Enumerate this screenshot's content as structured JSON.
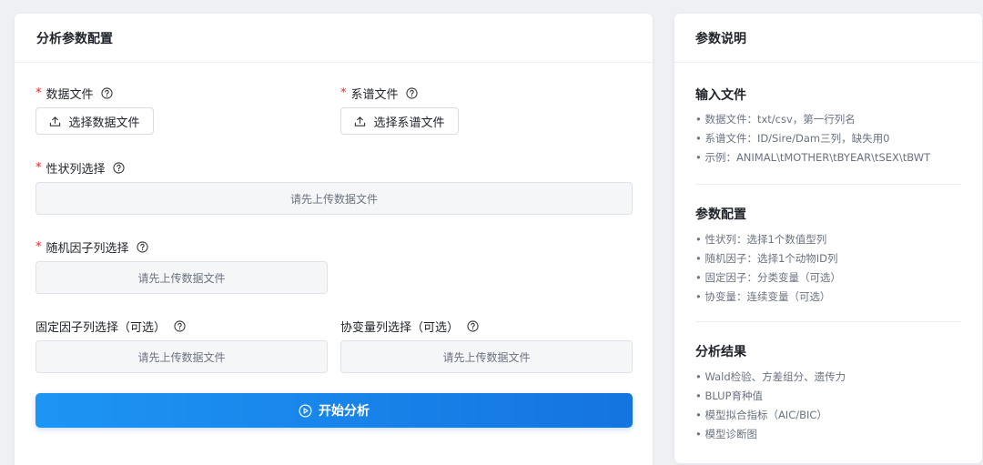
{
  "config_panel": {
    "title": "分析参数配置",
    "data_file": {
      "label": "数据文件",
      "button": "选择数据文件"
    },
    "pedigree_file": {
      "label": "系谱文件",
      "button": "选择系谱文件"
    },
    "trait_column": {
      "label": "性状列选择",
      "placeholder": "请先上传数据文件"
    },
    "random_factor": {
      "label": "随机因子列选择",
      "placeholder": "请先上传数据文件"
    },
    "fixed_factor": {
      "label": "固定因子列选择（可选）",
      "placeholder": "请先上传数据文件"
    },
    "covariate": {
      "label": "协变量列选择（可选）",
      "placeholder": "请先上传数据文件"
    },
    "start_button": "开始分析"
  },
  "help_panel": {
    "title": "参数说明",
    "sections": [
      {
        "title": "输入文件",
        "items": [
          "• 数据文件：txt/csv，第一行列名",
          "• 系谱文件：ID/Sire/Dam三列，缺失用0",
          "• 示例：ANIMAL\\tMOTHER\\tBYEAR\\tSEX\\tBWT"
        ]
      },
      {
        "title": "参数配置",
        "items": [
          "• 性状列：选择1个数值型列",
          "• 随机因子：选择1个动物ID列",
          "• 固定因子：分类变量（可选）",
          "• 协变量：连续变量（可选）"
        ]
      },
      {
        "title": "分析结果",
        "items": [
          "• Wald检验、方差组分、遗传力",
          "• BLUP育种值",
          "• 模型拟合指标（AIC/BIC）",
          "• 模型诊断图"
        ]
      }
    ]
  },
  "required_mark": "*",
  "colors": {
    "primary": "#1677ff",
    "required": "#f5222d",
    "muted_text": "#6b7280"
  }
}
